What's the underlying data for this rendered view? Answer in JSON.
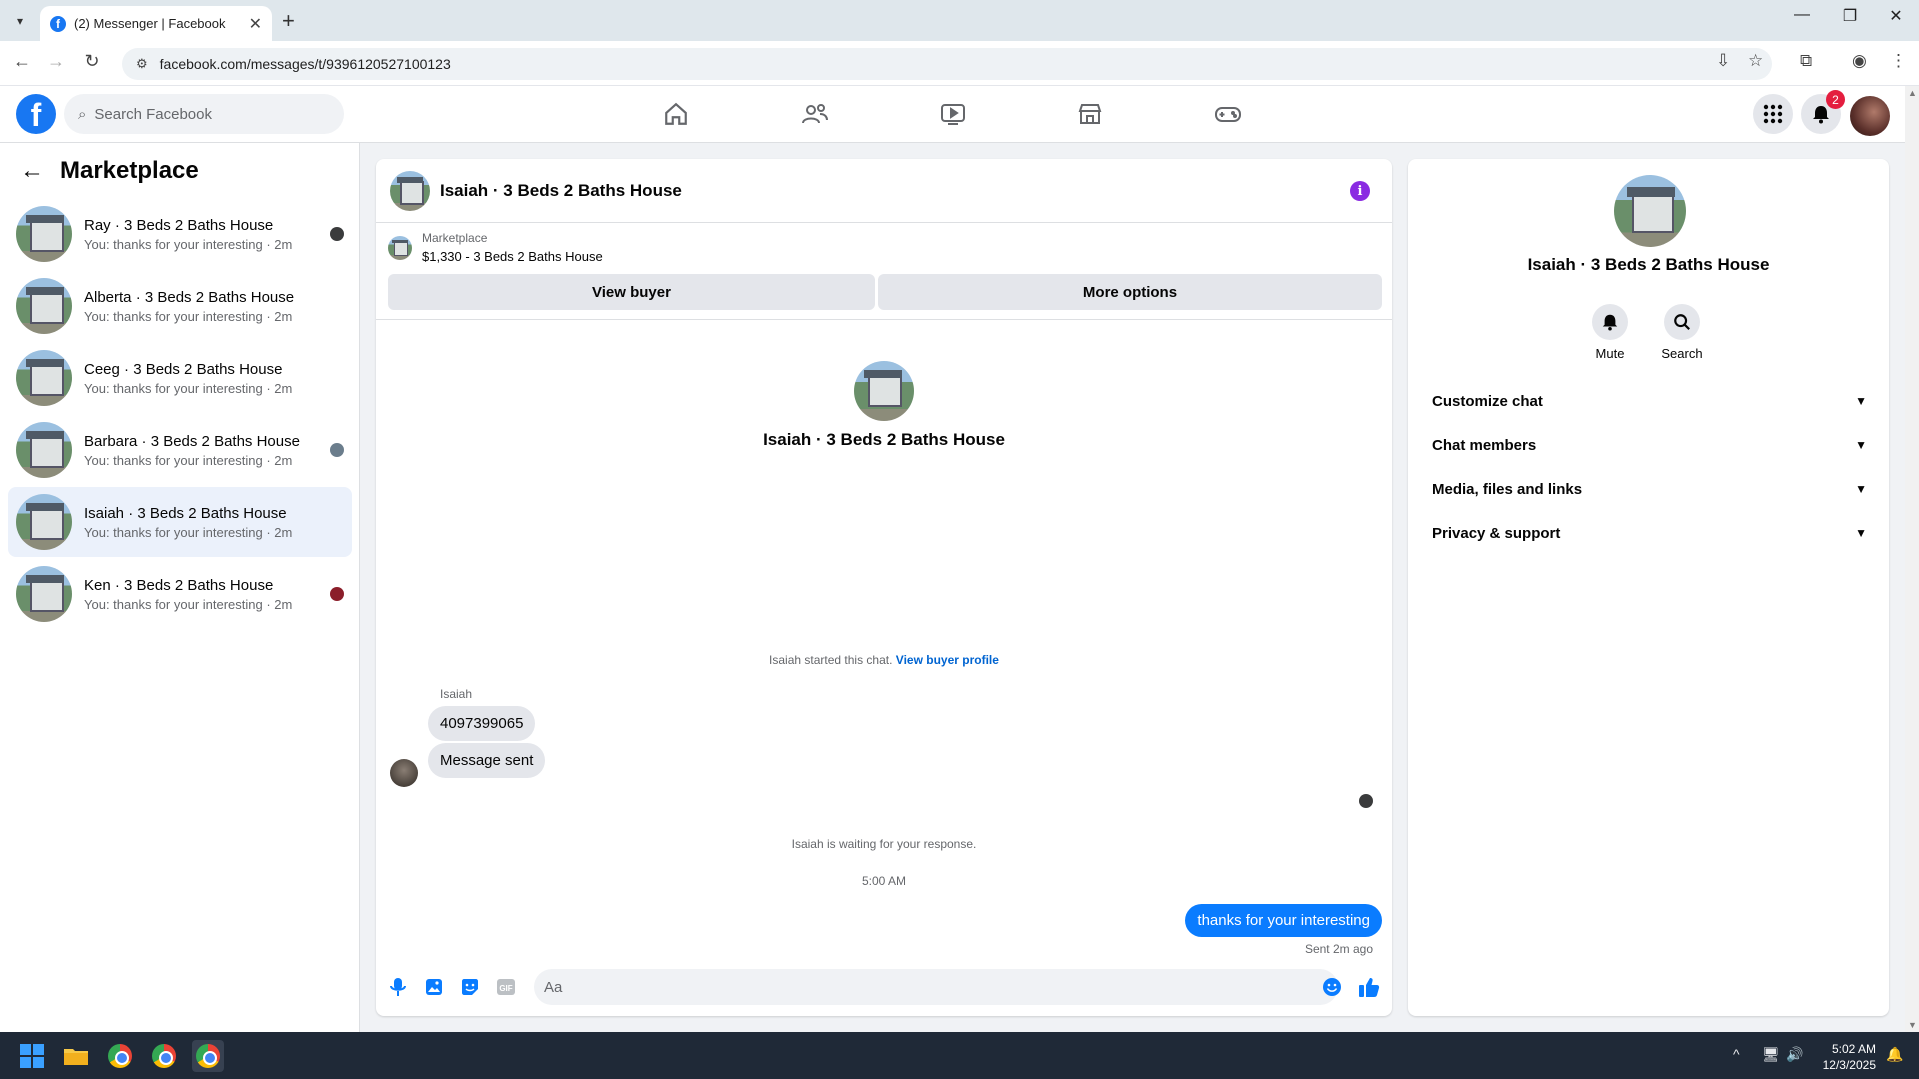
{
  "browser": {
    "tab_title": "(2) Messenger | Facebook",
    "url": "facebook.com/messages/t/9396120527100123"
  },
  "fb": {
    "search_placeholder": "Search Facebook",
    "notifications_count": "2",
    "brand_color": "#1877f2"
  },
  "sidebar": {
    "title": "Marketplace",
    "conversations": [
      {
        "name": "Ray · 3 Beds 2 Baths House",
        "preview": "You: thanks for your interesting · 2m"
      },
      {
        "name": "Alberta · 3 Beds 2 Baths House",
        "preview": "You: thanks for your interesting · 2m"
      },
      {
        "name": "Ceeg · 3 Beds 2 Baths House",
        "preview": "You: thanks for your interesting · 2m"
      },
      {
        "name": "Barbara · 3 Beds 2 Baths House",
        "preview": "You: thanks for your interesting · 2m"
      },
      {
        "name": "Isaiah · 3 Beds 2 Baths House",
        "preview": "You: thanks for your interesting · 2m"
      },
      {
        "name": "Ken · 3 Beds 2 Baths House",
        "preview": "You: thanks for your interesting · 2m"
      }
    ]
  },
  "chat": {
    "title": "Isaiah · 3 Beds 2 Baths House",
    "marketplace_label": "Marketplace",
    "listing": "$1,330 - 3 Beds 2 Baths House",
    "view_buyer": "View buyer",
    "more_options": "More options",
    "intro_name": "Isaiah · 3 Beds 2 Baths House",
    "started_text": "Isaiah started this chat.",
    "view_buyer_profile": "View buyer profile",
    "sender": "Isaiah",
    "messages_in": [
      "4097399065",
      "Message sent"
    ],
    "waiting": "Isaiah is waiting for your response.",
    "timestamp": "5:00 AM",
    "message_out": "thanks for your interesting",
    "sent_status": "Sent 2m ago",
    "composer_placeholder": "Aa",
    "outgoing_color": "#0a7cff"
  },
  "info": {
    "name": "Isaiah · 3 Beds 2 Baths House",
    "mute": "Mute",
    "search": "Search",
    "sections": [
      "Customize chat",
      "Chat members",
      "Media, files and links",
      "Privacy & support"
    ]
  },
  "taskbar": {
    "time": "5:02 AM",
    "date": "12/3/2025"
  }
}
